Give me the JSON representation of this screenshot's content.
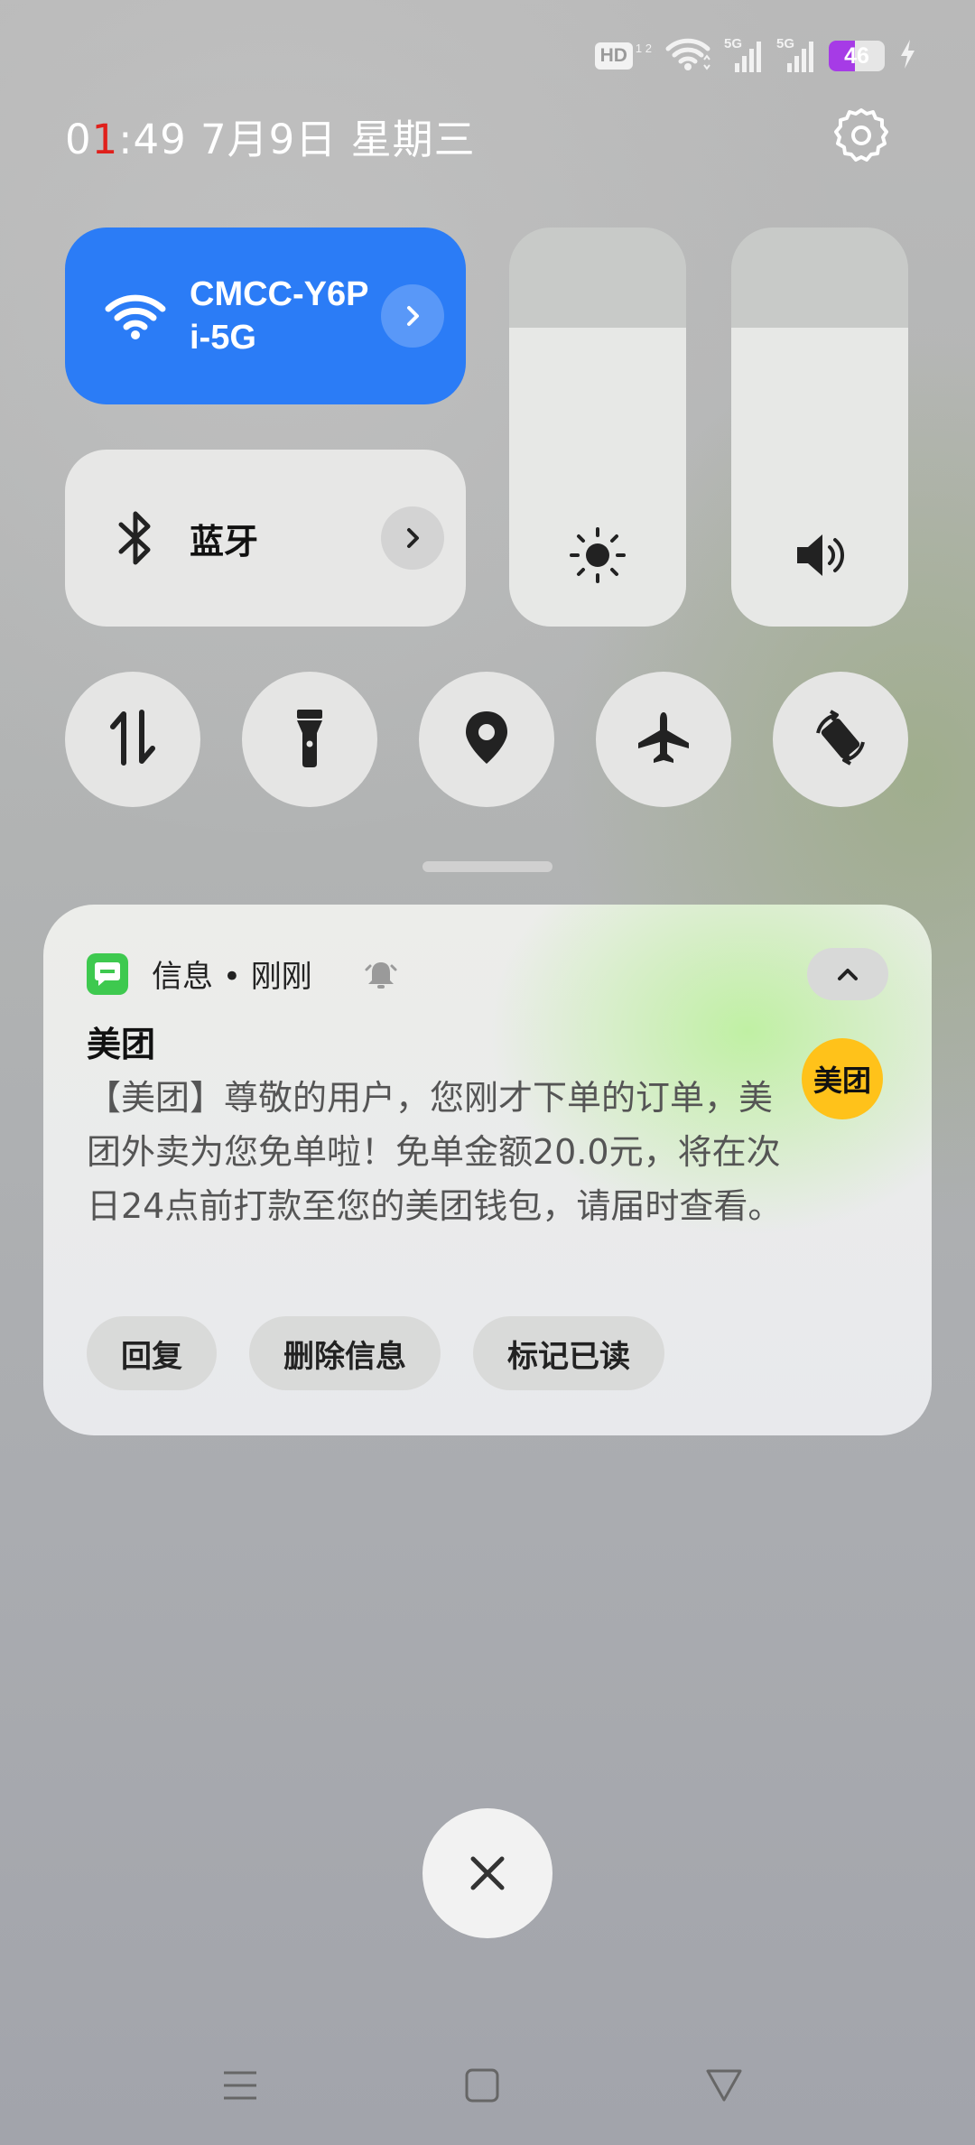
{
  "status_bar": {
    "hd_label": "HD",
    "hd_sub": "1 2",
    "sim1_tag": "5G",
    "sim2_tag": "5G",
    "battery_level": "46",
    "battery_fraction": 0.46,
    "icons": [
      "wifi-icon",
      "signal-icon",
      "signal-icon",
      "battery-icon",
      "charging-icon"
    ]
  },
  "header": {
    "time_a": "0",
    "time_b": "1",
    "time_c": ":49",
    "date": "7月9日",
    "weekday": "星期三",
    "settings_icon": "gear-icon"
  },
  "tiles": {
    "wifi": {
      "label": "CMCC-Y6Pi-5G",
      "active": true,
      "color": "#2b7cf6"
    },
    "bluetooth": {
      "label": "蓝牙",
      "active": false
    }
  },
  "sliders": {
    "brightness": {
      "level": 0.75,
      "icon": "sun-icon"
    },
    "volume": {
      "level": 0.75,
      "icon": "speaker-icon"
    }
  },
  "toggles": [
    {
      "name": "mobile-data",
      "icon": "data-arrows-icon"
    },
    {
      "name": "flashlight",
      "icon": "flashlight-icon"
    },
    {
      "name": "location",
      "icon": "location-pin-icon"
    },
    {
      "name": "airplane-mode",
      "icon": "airplane-icon"
    },
    {
      "name": "auto-rotate",
      "icon": "rotate-icon"
    }
  ],
  "notification": {
    "app_name": "信息",
    "separator": "•",
    "time": "刚刚",
    "title": "美团",
    "body": "【美团】尊敬的用户，您刚才下单的订单，美团外卖为您免单啦！免单金额20.0元，将在次日24点前打款至您的美团钱包，请届时查看。",
    "avatar_text": "美团",
    "avatar_color": "#ffc21a",
    "actions": [
      "回复",
      "删除信息",
      "标记已读"
    ]
  },
  "accent_colors": {
    "wifi_active": "#2b7cf6",
    "battery": "#a63be6",
    "time_red": "#e0201b"
  }
}
